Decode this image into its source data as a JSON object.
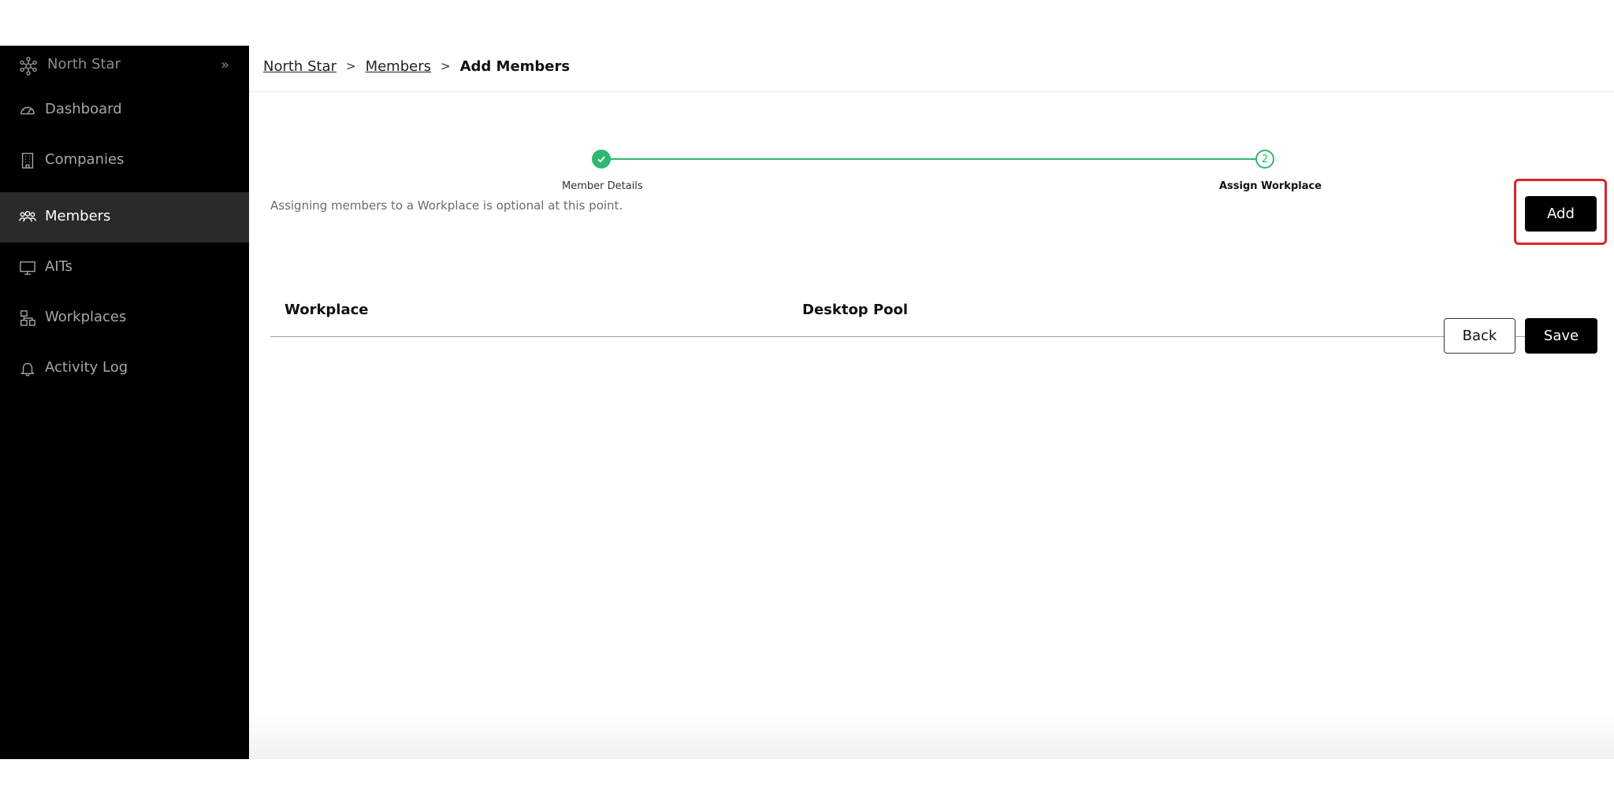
{
  "brand": {
    "name": "North Star",
    "icon": "network-icon",
    "collapse_icon": "double-chevron-right-icon",
    "collapse_glyph": "»"
  },
  "sidebar": {
    "items": [
      {
        "label": "Dashboard",
        "icon": "gauge-icon",
        "active": false
      },
      {
        "label": "Companies",
        "icon": "building-icon",
        "active": false
      },
      {
        "label": "Members",
        "icon": "users-icon",
        "active": true
      },
      {
        "label": "AITs",
        "icon": "monitor-icon",
        "active": false
      },
      {
        "label": "Workplaces",
        "icon": "hierarchy-icon",
        "active": false
      },
      {
        "label": "Activity Log",
        "icon": "bell-icon",
        "active": false
      }
    ]
  },
  "breadcrumb": {
    "items": [
      "North Star",
      "Members"
    ],
    "separator": ">",
    "current": "Add Members"
  },
  "stepper": {
    "steps": [
      {
        "label": "Member Details",
        "status": "completed"
      },
      {
        "label": "Assign Workplace",
        "number": "2",
        "status": "current"
      }
    ],
    "color": "#2fb86e"
  },
  "hint": "Assigning members to a Workplace is optional at this point.",
  "table": {
    "columns": [
      "Workplace",
      "Desktop Pool"
    ]
  },
  "actions": {
    "add": "Add",
    "back": "Back",
    "save": "Save"
  },
  "colors": {
    "sidebar_bg": "#000000",
    "sidebar_active": "#2a2a2a",
    "highlight": "#d9252b"
  }
}
